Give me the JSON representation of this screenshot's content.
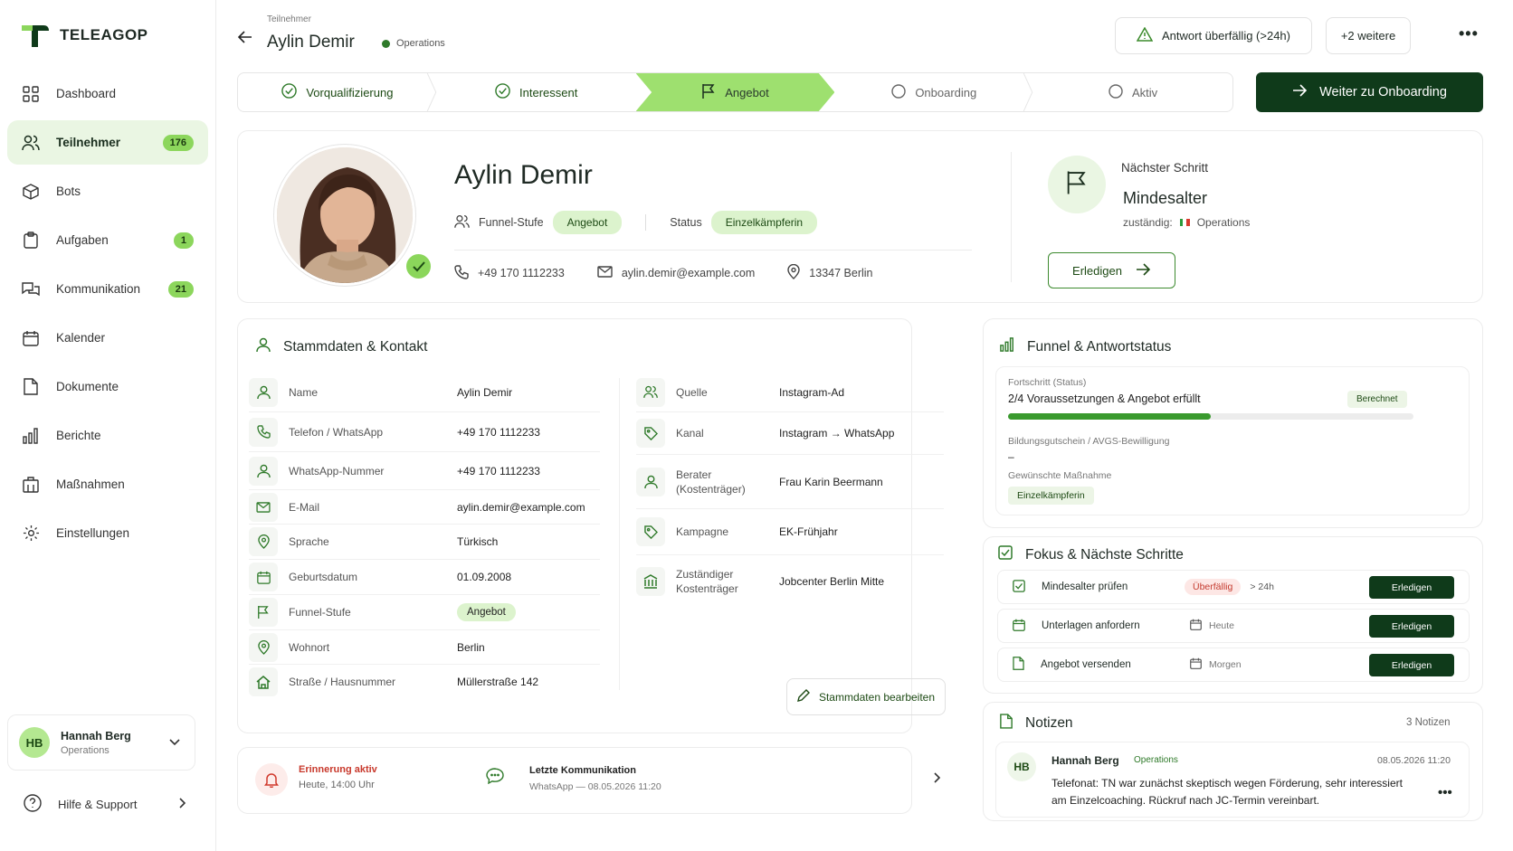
{
  "brand": {
    "name": "TELEAGOP",
    "accent": "#8cd65c",
    "dark": "#0f3a1a"
  },
  "sidebar": {
    "items": [
      {
        "label": "Dashboard",
        "icon": "grid-icon"
      },
      {
        "label": "Teilnehmer",
        "icon": "users-icon",
        "badge": "176",
        "active": true
      },
      {
        "label": "Bots",
        "icon": "bot-icon"
      },
      {
        "label": "Aufgaben",
        "icon": "clipboard-icon",
        "badge": "1"
      },
      {
        "label": "Kommunikation",
        "icon": "chat-icon",
        "badge": "21"
      },
      {
        "label": "Kalender",
        "icon": "calendar-icon"
      },
      {
        "label": "Dokumente",
        "icon": "document-icon"
      },
      {
        "label": "Berichte",
        "icon": "bar-chart-icon"
      },
      {
        "label": "Maßnahmen",
        "icon": "building-icon"
      },
      {
        "label": "Einstellungen",
        "icon": "gear-icon"
      }
    ],
    "user": {
      "initials": "HB",
      "name": "Hannah Berg",
      "role": "Operations"
    },
    "help": "Hilfe & Support"
  },
  "header": {
    "breadcrumb": "Teilnehmer",
    "title": "Aylin Demir",
    "status": "Operations",
    "alert": "Antwort überfällig (>24h)",
    "more": "+2 weitere"
  },
  "stepper": {
    "steps": [
      {
        "label": "Vorqualifizierung",
        "state": "done"
      },
      {
        "label": "Interessent",
        "state": "done"
      },
      {
        "label": "Angebot",
        "state": "current"
      },
      {
        "label": "Onboarding",
        "state": "todo"
      },
      {
        "label": "Aktiv",
        "state": "todo"
      }
    ],
    "cta": "Weiter zu Onboarding"
  },
  "profile": {
    "name": "Aylin Demir",
    "funnel_label": "Funnel-Stufe",
    "funnel_value": "Angebot",
    "status_label": "Status",
    "status_value": "Einzelkämpferin",
    "phone": "+49 170 1112233",
    "email": "aylin.demir@example.com",
    "location": "13347 Berlin",
    "next_step_label": "Nächster Schritt",
    "next_step_title": "Mindesalter",
    "responsible_label": "zuständig:",
    "responsible_value": "Operations",
    "done_button": "Erledigen"
  },
  "stammdaten": {
    "title": "Stammdaten & Kontakt",
    "left": [
      {
        "icon": "user-icon",
        "key": "Name",
        "value": "Aylin Demir"
      },
      {
        "icon": "phone-icon",
        "key": "Telefon / WhatsApp",
        "value": "+49 170 1112233"
      },
      {
        "icon": "user-icon",
        "key": "WhatsApp-Nummer",
        "value": "+49 170 1112233"
      },
      {
        "icon": "mail-icon",
        "key": "E-Mail",
        "value": "aylin.demir@example.com"
      },
      {
        "icon": "location-icon",
        "key": "Sprache",
        "value": "Türkisch"
      },
      {
        "icon": "calendar-icon",
        "key": "Geburtsdatum",
        "value": "01.09.2008"
      },
      {
        "icon": "flag-icon",
        "key": "Funnel-Stufe",
        "value": "Angebot"
      },
      {
        "icon": "location-icon",
        "key": "Wohnort",
        "value": "Berlin"
      },
      {
        "icon": "home-icon",
        "key": "Straße / Hausnummer",
        "value": "Müllerstraße 142"
      }
    ],
    "right": [
      {
        "icon": "users-icon",
        "key": "Quelle",
        "value": "Instagram-Ad"
      },
      {
        "icon": "tag-icon",
        "key": "Kanal",
        "value": "Instagram → WhatsApp"
      },
      {
        "icon": "user-icon",
        "key": "Berater (Kostenträger)",
        "value": "Frau Karin Beermann"
      },
      {
        "icon": "tag-icon",
        "key": "Kampagne",
        "value": "EK-Frühjahr"
      },
      {
        "icon": "bank-icon",
        "key": "Zuständiger Kostenträger",
        "value": "Jobcenter Berlin Mitte"
      }
    ],
    "edit_button": "Stammdaten bearbeiten"
  },
  "reminder": {
    "title": "Erinnerung aktiv",
    "time": "Heute, 14:00 Uhr",
    "comm_title": "Letzte Kommunikation",
    "comm_detail": "WhatsApp — 08.05.2026 11:20"
  },
  "funnel": {
    "title": "Funnel & Antwortstatus",
    "progress_label": "Fortschritt (Status)",
    "progress_text": "2/4 Voraussetzungen & Angebot erfüllt",
    "progress_badge": "Berechnet",
    "progress_value": 0.5,
    "voucher_label": "Bildungsgutschein / AVGS-Bewilligung",
    "voucher_value": "–",
    "measure_label": "Gewünschte Maßnahme",
    "measure_value": "Einzelkämpferin"
  },
  "fokus": {
    "title": "Fokus & Nächste Schritte",
    "tasks": [
      {
        "label": "Mindesalter prüfen",
        "tag": "Überfällig",
        "due": "> 24h",
        "button": "Erledigen"
      },
      {
        "label": "Unterlagen anfordern",
        "due": "Heute",
        "button": "Erledigen"
      },
      {
        "label": "Angebot versenden",
        "due": "Morgen",
        "button": "Erledigen"
      }
    ]
  },
  "notes": {
    "title": "Notizen",
    "count": "3 Notizen",
    "item": {
      "initials": "HB",
      "author": "Hannah Berg",
      "role": "Operations",
      "date": "08.05.2026 11:20",
      "text": "Telefonat: TN war zunächst skeptisch wegen Förderung, sehr interessiert am Einzelcoaching. Rückruf nach JC-Termin vereinbart."
    }
  }
}
